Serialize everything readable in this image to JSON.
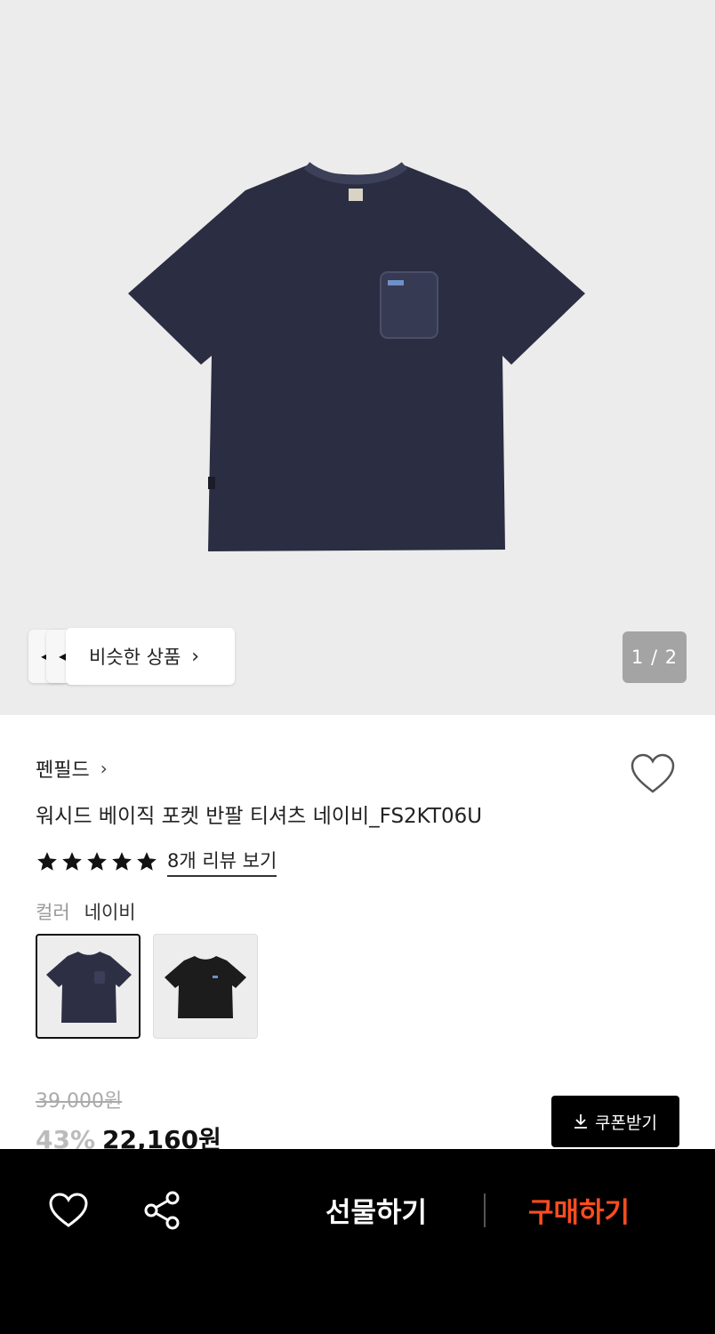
{
  "hero": {
    "image_alt": "washed navy pocket t-shirt",
    "similar_label": "비슷한 상품",
    "pager": "1 / 2"
  },
  "product": {
    "brand": "펜필드",
    "title": "워시드 베이직 포켓 반팔 티셔츠 네이비_FS2KT06U",
    "rating_stars": 5,
    "review_link": "8개 리뷰 보기",
    "color_label": "컬러",
    "color_value": "네이비",
    "swatches": [
      {
        "name": "navy",
        "color": "#2d3045",
        "selected": true
      },
      {
        "name": "black",
        "color": "#1c1c1c",
        "selected": false
      }
    ],
    "original_price": "39,000원",
    "discount": "43%",
    "sale_price": "22,160원",
    "coupon_button": "쿠폰받기"
  },
  "bottom_bar": {
    "gift_label": "선물하기",
    "buy_label": "구매하기",
    "buy_color": "#ff4c1f"
  },
  "colors": {
    "hero_bg": "#ececec",
    "tee_navy": "#2b2e42",
    "bar_bg": "#000000"
  }
}
